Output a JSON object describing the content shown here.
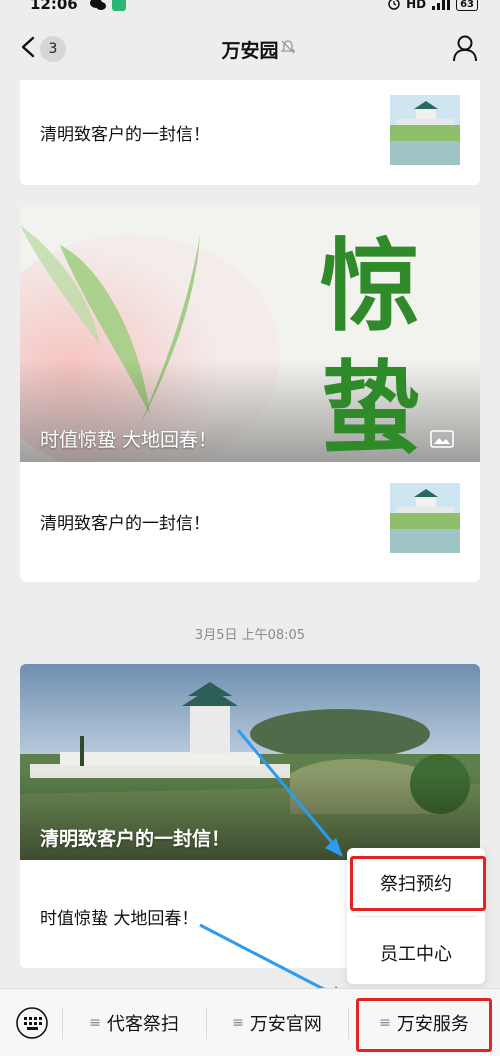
{
  "status": {
    "time": "12:06",
    "right_text": "HD",
    "battery": "63"
  },
  "nav": {
    "unread_count": "3",
    "title": "万安园"
  },
  "articles": [
    {
      "title": "清明致客户的一封信！"
    },
    {
      "cover_caption": "时值惊蛰 大地回春！",
      "cover_art_text": "惊蛰",
      "sub_title": "清明致客户的一封信！"
    },
    {
      "cover_caption": "清明致客户的一封信！",
      "sub_title": "时值惊蛰 大地回春！"
    }
  ],
  "timestamp": "3月5日 上午08:05",
  "menu": {
    "items": [
      "代客祭扫",
      "万安官网",
      "万安服务"
    ],
    "submenu": [
      "祭扫预约",
      "员工中心"
    ]
  },
  "colors": {
    "highlight": "#e02424",
    "arrow": "#2e9bf0"
  }
}
